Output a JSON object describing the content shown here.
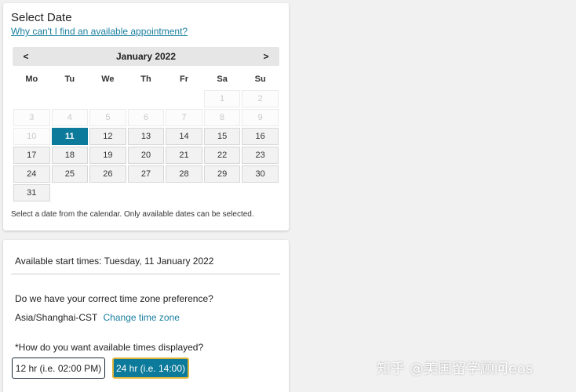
{
  "date_section": {
    "title": "Select Date",
    "help_link": "Why can't I find an available appointment?",
    "month_label": "January 2022",
    "prev_label": "<",
    "next_label": ">",
    "weekdays": [
      "Mo",
      "Tu",
      "We",
      "Th",
      "Fr",
      "Sa",
      "Su"
    ],
    "weeks": [
      [
        {
          "d": "",
          "s": "empty"
        },
        {
          "d": "",
          "s": "empty"
        },
        {
          "d": "",
          "s": "empty"
        },
        {
          "d": "",
          "s": "empty"
        },
        {
          "d": "",
          "s": "empty"
        },
        {
          "d": "1",
          "s": "disabled"
        },
        {
          "d": "2",
          "s": "disabled"
        }
      ],
      [
        {
          "d": "3",
          "s": "disabled"
        },
        {
          "d": "4",
          "s": "disabled"
        },
        {
          "d": "5",
          "s": "disabled"
        },
        {
          "d": "6",
          "s": "disabled"
        },
        {
          "d": "7",
          "s": "disabled"
        },
        {
          "d": "8",
          "s": "disabled"
        },
        {
          "d": "9",
          "s": "disabled"
        }
      ],
      [
        {
          "d": "10",
          "s": "disabled"
        },
        {
          "d": "11",
          "s": "selected"
        },
        {
          "d": "12",
          "s": "enabled"
        },
        {
          "d": "13",
          "s": "enabled"
        },
        {
          "d": "14",
          "s": "enabled"
        },
        {
          "d": "15",
          "s": "enabled"
        },
        {
          "d": "16",
          "s": "enabled"
        }
      ],
      [
        {
          "d": "17",
          "s": "enabled"
        },
        {
          "d": "18",
          "s": "enabled"
        },
        {
          "d": "19",
          "s": "enabled"
        },
        {
          "d": "20",
          "s": "enabled"
        },
        {
          "d": "21",
          "s": "enabled"
        },
        {
          "d": "22",
          "s": "enabled"
        },
        {
          "d": "23",
          "s": "enabled"
        }
      ],
      [
        {
          "d": "24",
          "s": "enabled"
        },
        {
          "d": "25",
          "s": "enabled"
        },
        {
          "d": "26",
          "s": "enabled"
        },
        {
          "d": "27",
          "s": "enabled"
        },
        {
          "d": "28",
          "s": "enabled"
        },
        {
          "d": "29",
          "s": "enabled"
        },
        {
          "d": "30",
          "s": "enabled"
        }
      ],
      [
        {
          "d": "31",
          "s": "enabled"
        },
        {
          "d": "",
          "s": "empty"
        },
        {
          "d": "",
          "s": "empty"
        },
        {
          "d": "",
          "s": "empty"
        },
        {
          "d": "",
          "s": "empty"
        },
        {
          "d": "",
          "s": "empty"
        },
        {
          "d": "",
          "s": "empty"
        }
      ]
    ],
    "note": "Select a date from the calendar. Only available dates can be selected."
  },
  "times_section": {
    "title": "Available start times: Tuesday, 11 January 2022",
    "tz_question": "Do we have your correct time zone preference?",
    "tz_value": "Asia/Shanghai-CST",
    "tz_change": "Change time zone",
    "format_question": "*How do you want available times displayed?",
    "btn_12": "12 hr (i.e. 02:00 PM)",
    "btn_24": "24 hr (i.e. 14:00)"
  },
  "watermark": "知乎 @美国留学顾问eos",
  "colors": {
    "accent": "#0c7a9a",
    "link": "#1a7fa0",
    "focus_border": "#e0b33a"
  }
}
